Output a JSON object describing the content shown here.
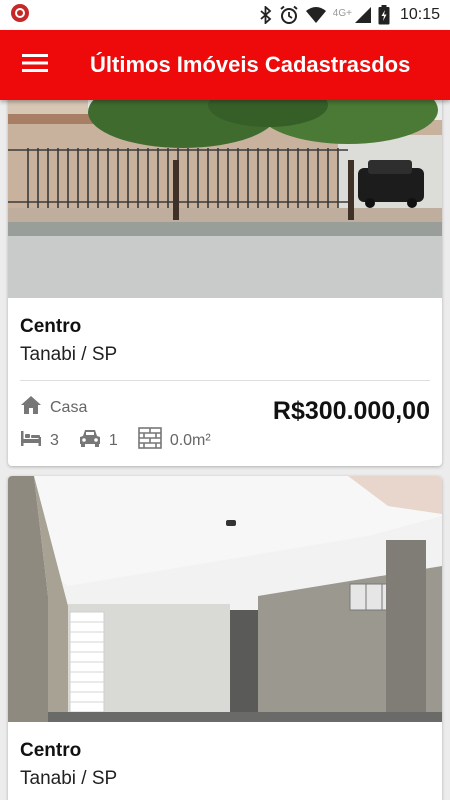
{
  "status_bar": {
    "network": "4G+",
    "time": "10:15",
    "icons": [
      "app-notification-icon",
      "bluetooth-icon",
      "alarm-icon",
      "wifi-icon",
      "signal-icon",
      "battery-charging-icon"
    ]
  },
  "app_bar": {
    "menu_icon": "hamburger-menu-icon",
    "title": "Últimos Imóveis Cadastrasdos"
  },
  "theme": {
    "primary": "#ee0a0a",
    "text": "#111111",
    "muted": "#666666"
  },
  "listings": [
    {
      "neighborhood": "Centro",
      "city": "Tanabi / SP",
      "type": "Casa",
      "bedrooms": "3",
      "parking": "1",
      "area": "0.0m²",
      "price": "R$300.000,00"
    },
    {
      "neighborhood": "Centro",
      "city": "Tanabi / SP"
    }
  ]
}
